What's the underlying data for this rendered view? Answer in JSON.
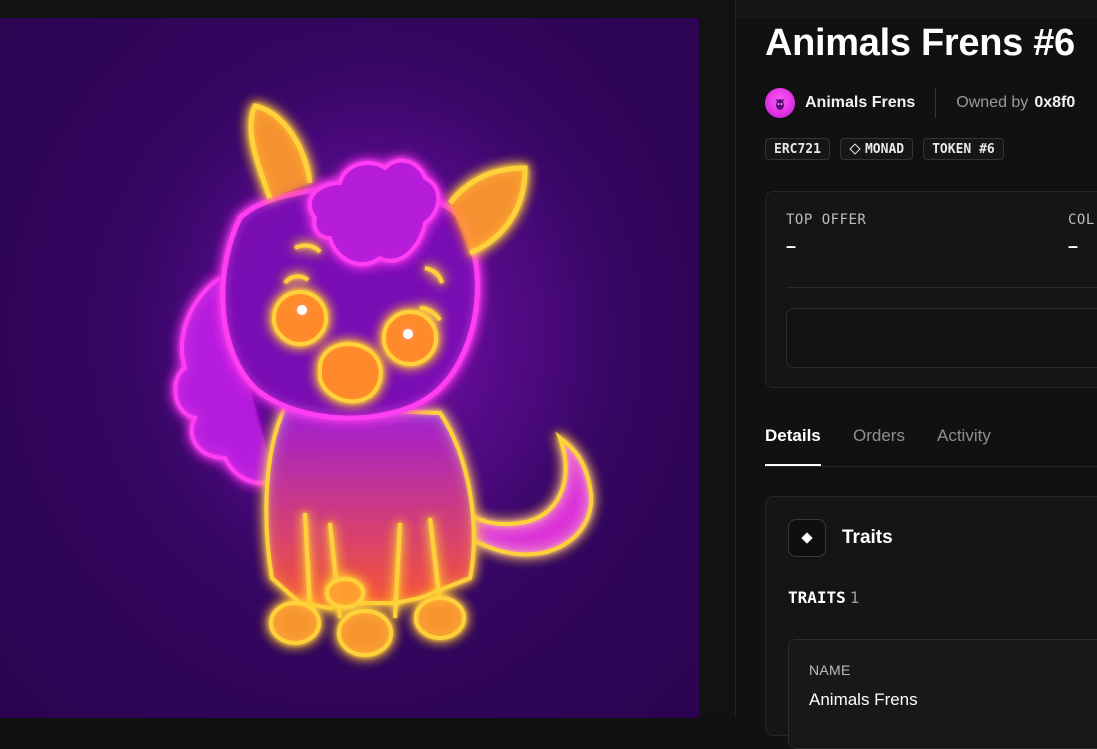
{
  "nft": {
    "title": "Animals Frens #6",
    "collection_name": "Animals Frens",
    "owned_by_label": "Owned by",
    "owner_address": "0x8f0"
  },
  "badges": [
    "ERC721",
    "MONAD",
    "TOKEN #6"
  ],
  "offer_card": {
    "top_offer_label": "TOP OFFER",
    "top_offer_value": "–",
    "second_label": "COL",
    "second_value": "–"
  },
  "tabs": [
    {
      "label": "Details",
      "active": true
    },
    {
      "label": "Orders",
      "active": false
    },
    {
      "label": "Activity",
      "active": false
    }
  ],
  "traits": {
    "section_title": "Traits",
    "count_label": "TRAITS",
    "count": "1",
    "items": [
      {
        "type": "NAME",
        "value": "Animals Frens"
      }
    ]
  },
  "colors": {
    "background": "#111111",
    "art_background": "#340661",
    "neon_pink": "#ff3ef2",
    "neon_yellow": "#ffd23a",
    "neon_orange": "#ff8a2a"
  },
  "icons": {
    "avatar": "collection-avatar-icon",
    "chain": "monad-diamond-icon",
    "traits": "diamond-icon"
  }
}
